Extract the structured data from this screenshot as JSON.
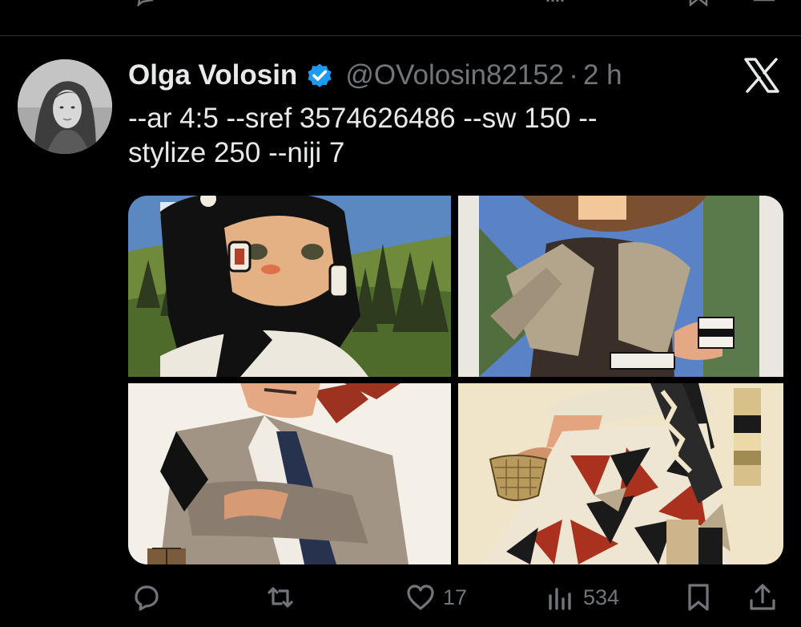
{
  "tweet": {
    "author": {
      "display_name": "Olga Volosin",
      "handle": "@OVolosin82152",
      "verified": true
    },
    "separator": "·",
    "time": "2 h",
    "text": "--ar 4:5 --sref 3574626486 --sw 150 --\nstylize 250 --niji 7",
    "media": [
      {
        "icon": "illustration-woman-earrings-forest"
      },
      {
        "icon": "illustration-woman-jacket-cup"
      },
      {
        "icon": "illustration-man-arms-crossed"
      },
      {
        "icon": "illustration-patchwork-dress-basket"
      }
    ],
    "actions": {
      "reply": {
        "icon": "reply-icon",
        "count": ""
      },
      "repost": {
        "icon": "repost-icon",
        "count": ""
      },
      "like": {
        "icon": "heart-icon",
        "count": "17"
      },
      "views": {
        "icon": "views-icon",
        "count": "534"
      },
      "bookmark": {
        "icon": "bookmark-icon"
      },
      "share": {
        "icon": "share-icon"
      }
    }
  },
  "brand": {
    "logo": "x-logo"
  },
  "colors": {
    "background": "#000000",
    "text": "#e7e9ea",
    "muted": "#71767b",
    "verified": "#1d9bf0",
    "divider": "#2f3336"
  }
}
